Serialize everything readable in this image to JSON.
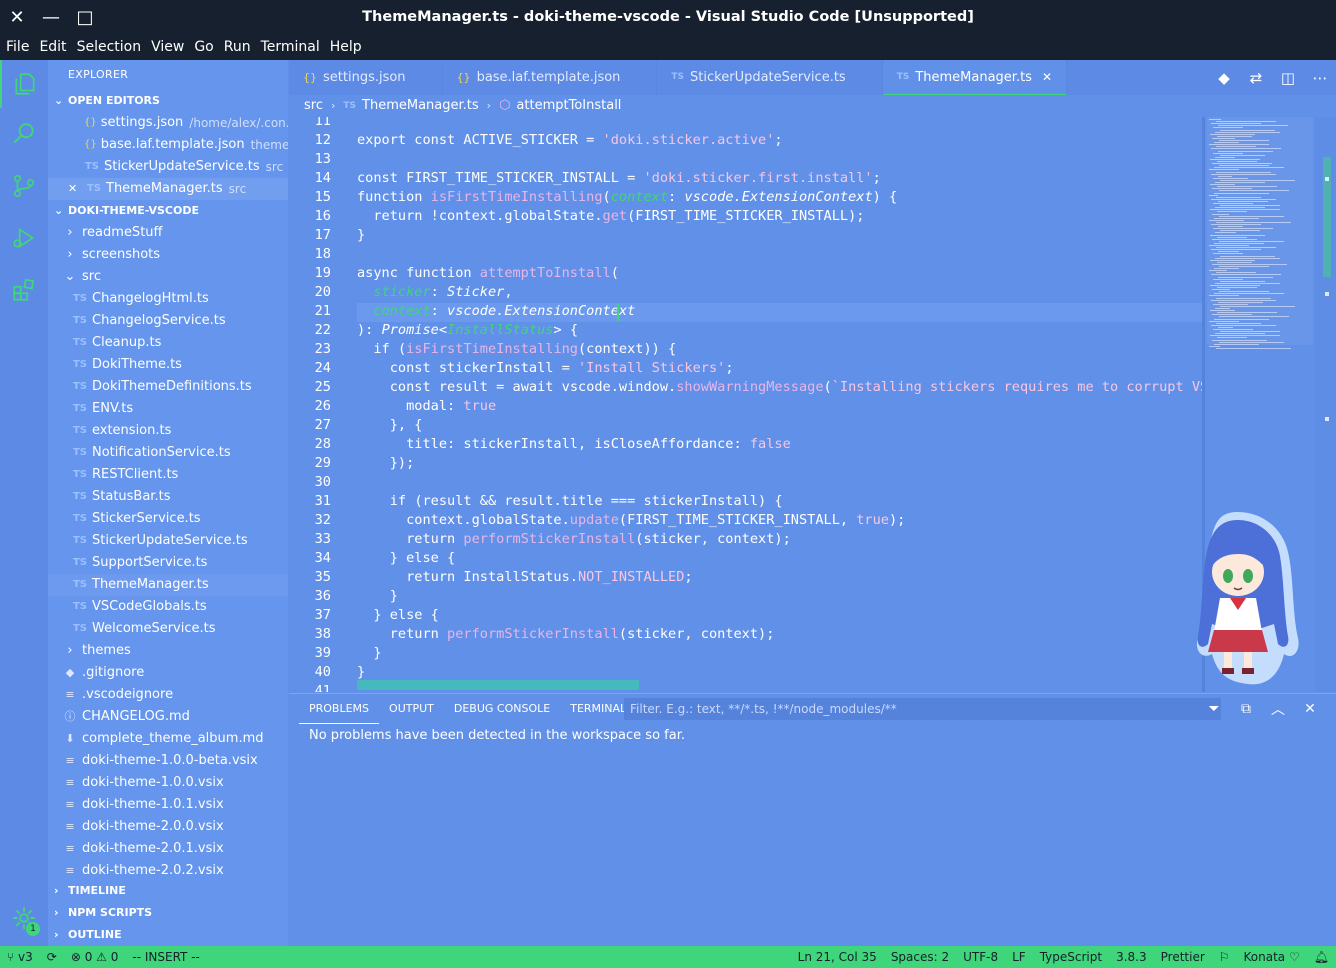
{
  "window": {
    "title": "ThemeManager.ts - doki-theme-vscode - Visual Studio Code [Unsupported]",
    "close": "✕",
    "minimize": "—",
    "maximize": "□"
  },
  "menu": [
    "File",
    "Edit",
    "Selection",
    "View",
    "Go",
    "Run",
    "Terminal",
    "Help"
  ],
  "colors": {
    "titlebar": "#16202e",
    "accent": "#3fd57a",
    "editor_bg": "#6190e8",
    "sidebar_bg": "#6595ec",
    "string": "#f6c6e6",
    "function": "#e8b5e8"
  },
  "sidebar": {
    "title": "EXPLORER",
    "open_editors": {
      "label": "OPEN EDITORS",
      "items": [
        {
          "name": "settings.json",
          "desc": "/home/alex/.con...",
          "icon": "{}"
        },
        {
          "name": "base.laf.template.json",
          "desc": "theme...",
          "icon": "{}"
        },
        {
          "name": "StickerUpdateService.ts",
          "desc": "src",
          "icon": "TS"
        },
        {
          "name": "ThemeManager.ts",
          "desc": "src",
          "icon": "TS",
          "close": "✕"
        }
      ]
    },
    "workspace": {
      "label": "DOKI-THEME-VSCODE",
      "items": [
        {
          "name": "readmeStuff",
          "type": "folder",
          "chevron": "›"
        },
        {
          "name": "screenshots",
          "type": "folder",
          "chevron": "›"
        },
        {
          "name": "src",
          "type": "folder-open",
          "chevron": "⌄"
        },
        {
          "name": "ChangelogHtml.ts",
          "type": "ts"
        },
        {
          "name": "ChangelogService.ts",
          "type": "ts"
        },
        {
          "name": "Cleanup.ts",
          "type": "ts"
        },
        {
          "name": "DokiTheme.ts",
          "type": "ts"
        },
        {
          "name": "DokiThemeDefinitions.ts",
          "type": "ts"
        },
        {
          "name": "ENV.ts",
          "type": "ts"
        },
        {
          "name": "extension.ts",
          "type": "ts"
        },
        {
          "name": "NotificationService.ts",
          "type": "ts"
        },
        {
          "name": "RESTClient.ts",
          "type": "ts"
        },
        {
          "name": "StatusBar.ts",
          "type": "ts"
        },
        {
          "name": "StickerService.ts",
          "type": "ts"
        },
        {
          "name": "StickerUpdateService.ts",
          "type": "ts"
        },
        {
          "name": "SupportService.ts",
          "type": "ts"
        },
        {
          "name": "ThemeManager.ts",
          "type": "ts",
          "selected": true
        },
        {
          "name": "VSCodeGlobals.ts",
          "type": "ts"
        },
        {
          "name": "WelcomeService.ts",
          "type": "ts"
        },
        {
          "name": "themes",
          "type": "folder",
          "chevron": "›"
        },
        {
          "name": ".gitignore",
          "type": "git"
        },
        {
          "name": ".vscodeignore",
          "type": "file"
        },
        {
          "name": "CHANGELOG.md",
          "type": "md"
        },
        {
          "name": "complete_theme_album.md",
          "type": "md2"
        },
        {
          "name": "doki-theme-1.0.0-beta.vsix",
          "type": "file"
        },
        {
          "name": "doki-theme-1.0.0.vsix",
          "type": "file"
        },
        {
          "name": "doki-theme-1.0.1.vsix",
          "type": "file"
        },
        {
          "name": "doki-theme-2.0.0.vsix",
          "type": "file"
        },
        {
          "name": "doki-theme-2.0.1.vsix",
          "type": "file"
        },
        {
          "name": "doki-theme-2.0.2.vsix",
          "type": "file"
        }
      ]
    },
    "timeline": "TIMELINE",
    "npm_scripts": "NPM SCRIPTS",
    "outline": "OUTLINE"
  },
  "tabs": [
    {
      "label": "settings.json",
      "icon": "{}"
    },
    {
      "label": "base.laf.template.json",
      "icon": "{}"
    },
    {
      "label": "StickerUpdateService.ts",
      "icon": "TS"
    },
    {
      "label": "ThemeManager.ts",
      "icon": "TS",
      "active": true,
      "close": "✕"
    }
  ],
  "breadcrumb": {
    "folder": "src",
    "file": "ThemeManager.ts",
    "symbol": "attemptToInstall"
  },
  "code": {
    "first_line": 11,
    "lines": [
      [],
      [
        [
          "kw",
          "export const "
        ],
        [
          "",
          "ACTIVE_STICKER = "
        ],
        [
          "str",
          "'doki.sticker.active'"
        ],
        [
          "",
          ";"
        ]
      ],
      [],
      [
        [
          "kw",
          "const "
        ],
        [
          "",
          "FIRST_TIME_STICKER_INSTALL = "
        ],
        [
          "str",
          "'doki.sticker.first.install'"
        ],
        [
          "",
          ";"
        ]
      ],
      [
        [
          "kw",
          "function "
        ],
        [
          "fn",
          "isFirstTimeInstalling"
        ],
        [
          "",
          "("
        ],
        [
          "par",
          "context"
        ],
        [
          "",
          ": "
        ],
        [
          "ty",
          "vscode.ExtensionContext"
        ],
        [
          "",
          ") {"
        ]
      ],
      [
        [
          "",
          "  "
        ],
        [
          "kw",
          "return "
        ],
        [
          "",
          "!context.globalState."
        ],
        [
          "fn",
          "get"
        ],
        [
          "",
          "(FIRST_TIME_STICKER_INSTALL);"
        ]
      ],
      [
        [
          "",
          "}"
        ]
      ],
      [],
      [
        [
          "kw",
          "async function "
        ],
        [
          "fn",
          "attemptToInstall"
        ],
        [
          "",
          "("
        ]
      ],
      [
        [
          "",
          "  "
        ],
        [
          "par",
          "sticker"
        ],
        [
          "",
          ": "
        ],
        [
          "ty",
          "Sticker"
        ],
        [
          "",
          ","
        ]
      ],
      [
        [
          "",
          "  "
        ],
        [
          "par",
          "context"
        ],
        [
          "",
          ": "
        ],
        [
          "ty",
          "vscode.ExtensionContext"
        ]
      ],
      [
        [
          "",
          "): "
        ],
        [
          "ty",
          "Promise"
        ],
        [
          "",
          "<"
        ],
        [
          "par",
          "InstallStatus"
        ],
        [
          "",
          "> {"
        ]
      ],
      [
        [
          "",
          "  "
        ],
        [
          "kw",
          "if "
        ],
        [
          "",
          "("
        ],
        [
          "fn",
          "isFirstTimeInstalling"
        ],
        [
          "",
          "(context)) {"
        ]
      ],
      [
        [
          "",
          "    "
        ],
        [
          "kw",
          "const "
        ],
        [
          "",
          "stickerInstall = "
        ],
        [
          "str",
          "'Install Stickers'"
        ],
        [
          "",
          ";"
        ]
      ],
      [
        [
          "",
          "    "
        ],
        [
          "kw",
          "const "
        ],
        [
          "",
          "result = "
        ],
        [
          "kw",
          "await "
        ],
        [
          "",
          "vscode.window."
        ],
        [
          "fn",
          "showWarningMessage"
        ],
        [
          "",
          "("
        ],
        [
          "str",
          "`Installing stickers requires me to corrupt VS-Code t"
        ]
      ],
      [
        [
          "",
          "      modal: "
        ],
        [
          "str",
          "true"
        ]
      ],
      [
        [
          "",
          "    }, {"
        ]
      ],
      [
        [
          "",
          "      title: stickerInstall, isCloseAffordance: "
        ],
        [
          "str",
          "false"
        ]
      ],
      [
        [
          "",
          "    });"
        ]
      ],
      [],
      [
        [
          "",
          "    "
        ],
        [
          "kw",
          "if "
        ],
        [
          "",
          "(result && result.title === stickerInstall) {"
        ]
      ],
      [
        [
          "",
          "      context.globalState."
        ],
        [
          "fn",
          "update"
        ],
        [
          "",
          "(FIRST_TIME_STICKER_INSTALL, "
        ],
        [
          "str",
          "true"
        ],
        [
          "",
          ");"
        ]
      ],
      [
        [
          "",
          "      "
        ],
        [
          "kw",
          "return "
        ],
        [
          "fn",
          "performStickerInstall"
        ],
        [
          "",
          "(sticker, context);"
        ]
      ],
      [
        [
          "",
          "    } "
        ],
        [
          "kw",
          "else "
        ],
        [
          "",
          "{"
        ]
      ],
      [
        [
          "",
          "      "
        ],
        [
          "kw",
          "return "
        ],
        [
          "",
          "InstallStatus."
        ],
        [
          "str",
          "NOT_INSTALLED"
        ],
        [
          "",
          ";"
        ]
      ],
      [
        [
          "",
          "    }"
        ]
      ],
      [
        [
          "",
          "  } "
        ],
        [
          "kw",
          "else "
        ],
        [
          "",
          "{"
        ]
      ],
      [
        [
          "",
          "    "
        ],
        [
          "kw",
          "return "
        ],
        [
          "fn",
          "performStickerInstall"
        ],
        [
          "",
          "(sticker, context);"
        ]
      ],
      [
        [
          "",
          "  }"
        ]
      ],
      [
        [
          "",
          "}"
        ]
      ],
      []
    ]
  },
  "panel": {
    "tabs": [
      "PROBLEMS",
      "OUTPUT",
      "DEBUG CONSOLE",
      "TERMINAL"
    ],
    "filter_placeholder": "Filter. E.g.: text, **/*.ts, !**/node_modules/**",
    "message": "No problems have been detected in the workspace so far."
  },
  "status": {
    "branch": "v3",
    "errors": "0",
    "warnings": "0",
    "mode": "-- INSERT --",
    "position": "Ln 21, Col 35",
    "spaces": "Spaces: 2",
    "encoding": "UTF-8",
    "eol": "LF",
    "language": "TypeScript",
    "version": "3.8.3",
    "formatter": "Prettier",
    "theme": "Konata",
    "settings_badge": "1"
  }
}
